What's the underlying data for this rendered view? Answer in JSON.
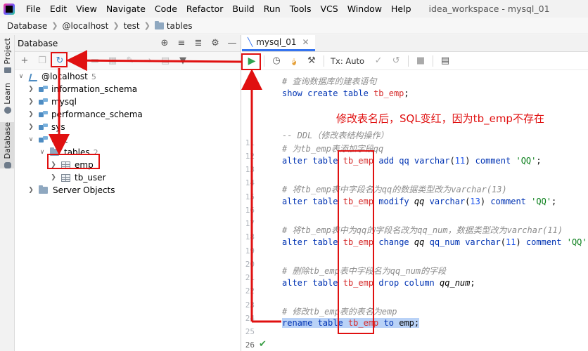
{
  "menubar": {
    "items": [
      "File",
      "Edit",
      "View",
      "Navigate",
      "Code",
      "Refactor",
      "Build",
      "Run",
      "Tools",
      "VCS",
      "Window",
      "Help"
    ],
    "window_title": "idea_workspace - mysql_01"
  },
  "navbar": {
    "crumbs": [
      "Database",
      "@localhost",
      "test",
      "tables"
    ]
  },
  "leftstripe": {
    "project": "Project",
    "learn": "Learn",
    "database": "Database"
  },
  "db_panel": {
    "title": "Database",
    "tree": {
      "host": "@localhost",
      "host_count": "5",
      "schemas": [
        "information_schema",
        "mysql",
        "performance_schema",
        "sys",
        "test"
      ],
      "tables_folder": "tables",
      "tables_count": "2",
      "tables": [
        "emp",
        "tb_user"
      ],
      "server_objects": "Server Objects"
    }
  },
  "editor": {
    "tab_label": "mysql_01",
    "tx_label": "Tx: Auto",
    "line_numbers": [
      "11",
      "12",
      "13",
      "14",
      "15",
      "16",
      "17",
      "18",
      "19",
      "20",
      "21",
      "22",
      "23",
      "24",
      "25",
      "26"
    ],
    "lines": {
      "l1_comment": "# 查询数据库的建表语句",
      "l2_kw": "show create table",
      "l2_name": "tb_emp",
      "l2_end": ";",
      "l3_comment": "-- DDL（修改表结构操作）",
      "l4_comment": "# 为tb_emp表添加字段qq",
      "l5_kw": "alter table",
      "l5_name": "tb_emp",
      "l5_rest_kw": "add",
      "l5_col": "qq",
      "l5_type": "varchar",
      "l5_open": "(",
      "l5_num": "11",
      "l5_close": ")",
      "l5_comment_kw": "comment",
      "l5_str": "'QQ'",
      "l5_end": ";",
      "l6_comment": "# 将tb_emp表中字段名为qq的数据类型改为varchar(13)",
      "l7_kw": "alter table",
      "l7_name": "tb_emp",
      "l7_rest_kw": "modify",
      "l7_col": "qq",
      "l7_type": "varchar",
      "l7_open": "(",
      "l7_num": "13",
      "l7_close": ")",
      "l7_comment_kw": "comment",
      "l7_str": "'QQ'",
      "l7_end": ";",
      "l8_comment": "# 将tb_emp表中为qq的字段名改为qq_num，数据类型改为varchar(11)",
      "l9_kw": "alter table",
      "l9_name": "tb_emp",
      "l9_rest_kw": "change",
      "l9_col": "qq",
      "l9_col2": "qq_num",
      "l9_type": "varchar",
      "l9_open": "(",
      "l9_num": "11",
      "l9_close": ")",
      "l9_comment_kw": "comment",
      "l9_str": "'QQ'",
      "l9_end": ";",
      "l10_comment": "# 删除tb_emp表中字段名为qq_num的字段",
      "l11_kw": "alter table",
      "l11_name": "tb_emp",
      "l11_rest_kw": "drop column",
      "l11_col": "qq_num",
      "l11_end": ";",
      "l12_comment": "# 修改tb_emp表的表名为emp",
      "l13_kw": "rename table",
      "l13_name": "tb_emp",
      "l13_to": "to",
      "l13_new": "emp",
      "l13_end": ";"
    }
  },
  "annotation": "修改表名后，SQL变红，因为tb_emp不存在",
  "colors": {
    "annotation_red": "#e01010",
    "keyword_blue": "#0033b3",
    "string_green": "#067d17",
    "run_green": "#2ea44f",
    "selection": "#b9d2f7"
  }
}
